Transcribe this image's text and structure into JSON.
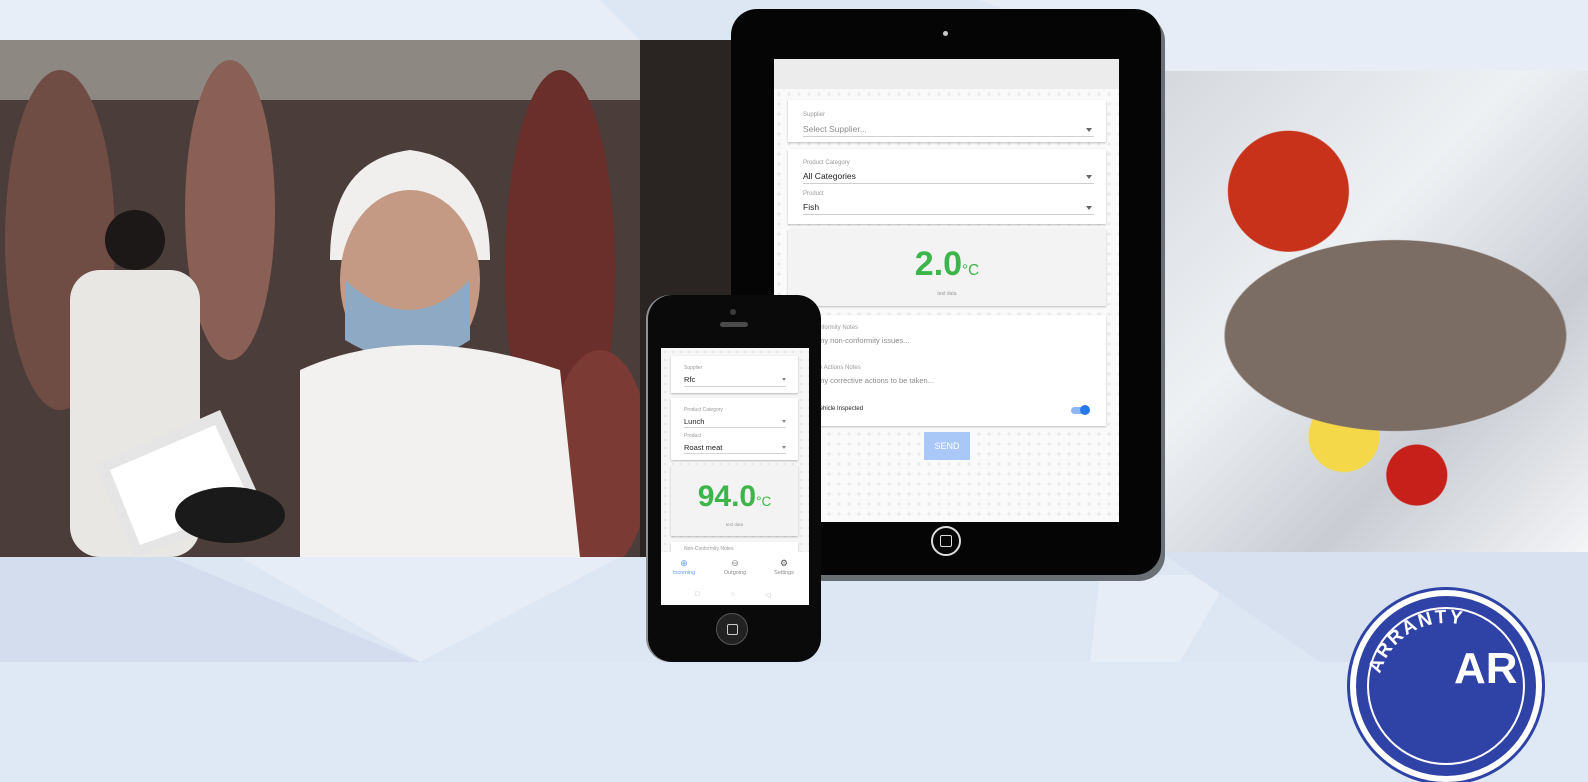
{
  "tablet": {
    "supplier_label": "Supplier",
    "supplier_placeholder": "Select Supplier...",
    "category_label": "Product Category",
    "category_value": "All Categories",
    "product_label": "Product",
    "product_value": "Fish",
    "temperature": "2.0",
    "temperature_unit": "°C",
    "temperature_note": "test data",
    "nonconformity_label": "onformity Notes",
    "nonconformity_placeholder": "any non-conformity issues...",
    "corrective_label": "ve Actions Notes",
    "corrective_placeholder": "any corrective actions to be taken...",
    "vehicle_label": "Vehicle Inspected",
    "vehicle_inspected": true,
    "send_label": "SEND"
  },
  "phone": {
    "supplier_label": "Supplier",
    "supplier_value": "Rfc",
    "category_label": "Product Category",
    "category_value": "Lunch",
    "product_label": "Product",
    "product_value": "Roast meat",
    "temperature": "94.0",
    "temperature_unit": "°C",
    "temperature_note": "test data",
    "nonconformity_label": "Non-Conformity Notes",
    "nav": [
      {
        "label": "Incoming",
        "icon": "incoming-icon",
        "active": true
      },
      {
        "label": "Outgoing",
        "icon": "outgoing-icon",
        "active": false
      },
      {
        "label": "Settings",
        "icon": "gear-icon",
        "active": false
      }
    ]
  },
  "badge": {
    "text": "ARRANTY",
    "letters": "AR"
  },
  "colors": {
    "accent_green": "#3cb54a",
    "accent_blue": "#2a78e8",
    "badge_blue": "#2f43a6"
  }
}
